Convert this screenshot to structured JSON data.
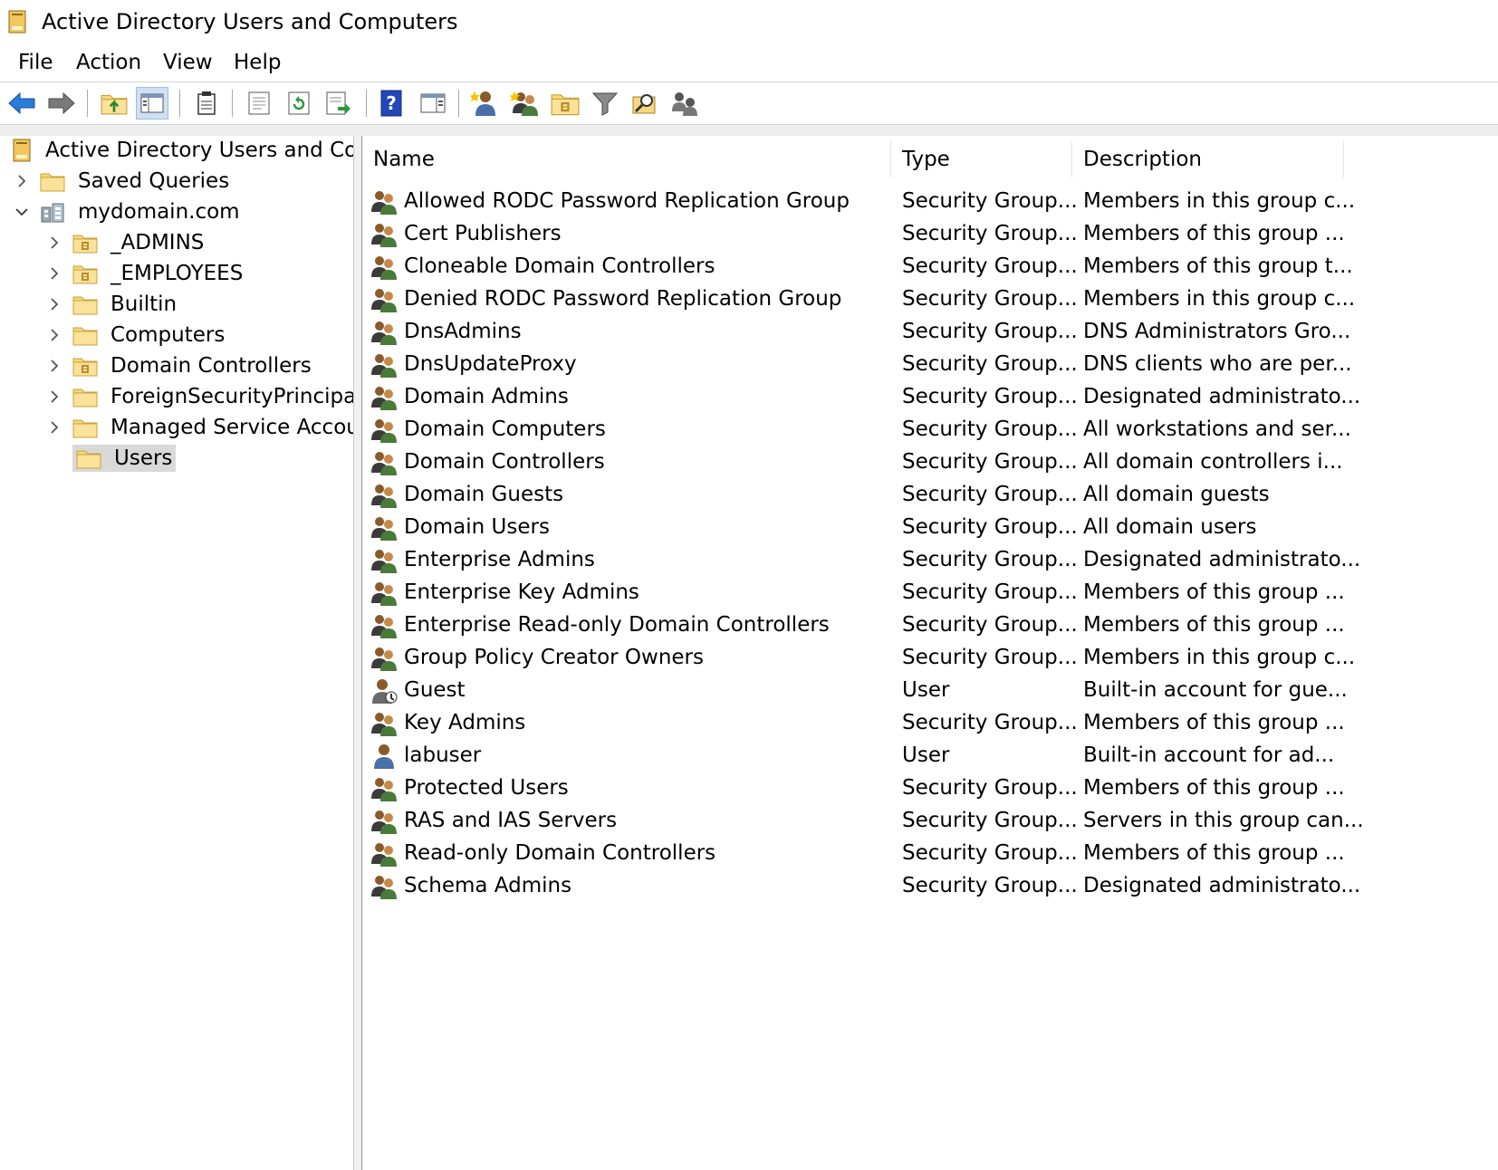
{
  "window": {
    "title": "Active Directory Users and Computers"
  },
  "menu": [
    "File",
    "Action",
    "View",
    "Help"
  ],
  "toolbar": {
    "buttons": [
      "back-icon",
      "forward-icon",
      "up-folder-icon",
      "show-hide-console-tree-icon",
      "clipboard-icon",
      "properties-icon",
      "refresh-icon",
      "export-list-icon",
      "help-icon",
      "action-pane-icon",
      "new-user-icon",
      "new-group-icon",
      "new-ou-icon",
      "filter-icon",
      "find-icon",
      "add-to-group-icon"
    ]
  },
  "tree": {
    "root": "Active Directory Users and Com",
    "saved_queries": "Saved Queries",
    "domain": "mydomain.com",
    "children": [
      "_ADMINS",
      "_EMPLOYEES",
      "Builtin",
      "Computers",
      "Domain Controllers",
      "ForeignSecurityPrincipals",
      "Managed Service Accounts",
      "Users"
    ],
    "selected": "Users"
  },
  "list": {
    "columns": [
      "Name",
      "Type",
      "Description"
    ],
    "rows": [
      {
        "name": "Allowed RODC Password Replication Group",
        "type": "Security Group...",
        "description": "Members in this group c...",
        "kind": "group"
      },
      {
        "name": "Cert Publishers",
        "type": "Security Group...",
        "description": "Members of this group ...",
        "kind": "group"
      },
      {
        "name": "Cloneable Domain Controllers",
        "type": "Security Group...",
        "description": "Members of this group t...",
        "kind": "group"
      },
      {
        "name": "Denied RODC Password Replication Group",
        "type": "Security Group...",
        "description": "Members in this group c...",
        "kind": "group"
      },
      {
        "name": "DnsAdmins",
        "type": "Security Group...",
        "description": "DNS Administrators Gro...",
        "kind": "group"
      },
      {
        "name": "DnsUpdateProxy",
        "type": "Security Group...",
        "description": "DNS clients who are per...",
        "kind": "group"
      },
      {
        "name": "Domain Admins",
        "type": "Security Group...",
        "description": "Designated administrato...",
        "kind": "group"
      },
      {
        "name": "Domain Computers",
        "type": "Security Group...",
        "description": "All workstations and ser...",
        "kind": "group"
      },
      {
        "name": "Domain Controllers",
        "type": "Security Group...",
        "description": "All domain controllers i...",
        "kind": "group"
      },
      {
        "name": "Domain Guests",
        "type": "Security Group...",
        "description": "All domain guests",
        "kind": "group"
      },
      {
        "name": "Domain Users",
        "type": "Security Group...",
        "description": "All domain users",
        "kind": "group"
      },
      {
        "name": "Enterprise Admins",
        "type": "Security Group...",
        "description": "Designated administrato...",
        "kind": "group"
      },
      {
        "name": "Enterprise Key Admins",
        "type": "Security Group...",
        "description": "Members of this group ...",
        "kind": "group"
      },
      {
        "name": "Enterprise Read-only Domain Controllers",
        "type": "Security Group...",
        "description": "Members of this group ...",
        "kind": "group"
      },
      {
        "name": "Group Policy Creator Owners",
        "type": "Security Group...",
        "description": "Members in this group c...",
        "kind": "group"
      },
      {
        "name": "Guest",
        "type": "User",
        "description": "Built-in account for gue...",
        "kind": "user-disabled"
      },
      {
        "name": "Key Admins",
        "type": "Security Group...",
        "description": "Members of this group ...",
        "kind": "group"
      },
      {
        "name": "labuser",
        "type": "User",
        "description": "Built-in account for ad...",
        "kind": "user"
      },
      {
        "name": "Protected Users",
        "type": "Security Group...",
        "description": "Members of this group ...",
        "kind": "group"
      },
      {
        "name": "RAS and IAS Servers",
        "type": "Security Group...",
        "description": "Servers in this group can...",
        "kind": "group"
      },
      {
        "name": "Read-only Domain Controllers",
        "type": "Security Group...",
        "description": "Members of this group ...",
        "kind": "group"
      },
      {
        "name": "Schema Admins",
        "type": "Security Group...",
        "description": "Designated administrato...",
        "kind": "group"
      }
    ]
  },
  "colors": {
    "accent": "#2b6ed4",
    "folder": "#f4d27a",
    "selection": "#d9d9d9"
  }
}
